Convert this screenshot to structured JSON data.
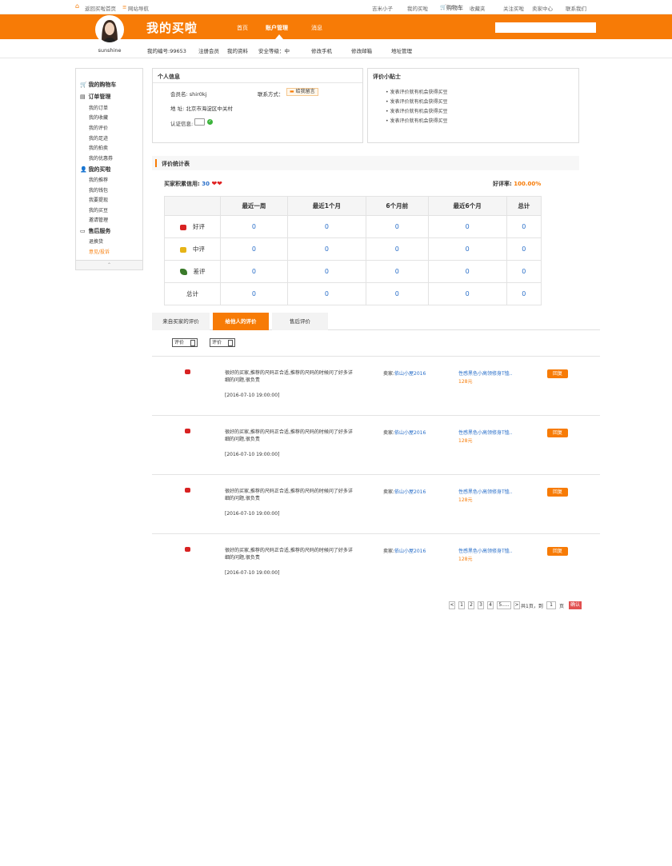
{
  "topbar": {
    "home": "返回买啦首页",
    "sitenav": "网站导航",
    "user": "吉米小子",
    "mybuy": "我的买啦",
    "cart": "购物车",
    "favorites": "收藏夹",
    "follow": "关注买啦",
    "seller": "卖家中心",
    "contact": "联系我们"
  },
  "header": {
    "brand": "我的买啦",
    "nav": [
      "首页",
      "账户管理",
      "消息"
    ],
    "search_placeholder": ""
  },
  "username": "sunshine",
  "subnav": {
    "member_no": "我的编号:99653",
    "items": [
      "注册会员",
      "我的资料",
      "安全等级：中",
      "修改手机",
      "修改邮箱",
      "地址管理"
    ]
  },
  "sidebar": {
    "sections": [
      {
        "title": "我的购物车",
        "items": []
      },
      {
        "title": "订单管理",
        "items": [
          "我的订单",
          "我的收藏",
          "我的评价",
          "我的足迹",
          "我的拍卖",
          "我的优惠券"
        ]
      },
      {
        "title": "我的买啦",
        "items": [
          "我的推荐",
          "我的钱包",
          "我要提现",
          "我的买豆",
          "邀请管理"
        ]
      },
      {
        "title": "售后服务",
        "items": [
          "退换货",
          "意见/投诉"
        ]
      }
    ],
    "fold": "⌃"
  },
  "personal": {
    "title": "个人信息",
    "member_name": "会员名: shir0kj",
    "contact_label": "联系方式：",
    "contact_btn": "给我留言",
    "address": "地  址: 北京市海淀区中关村",
    "auth_label": "认证信息:"
  },
  "tips": {
    "title": "评价小贴士",
    "items": [
      "发表评价就有机会获得买豆",
      "发表评价就有机会获得买豆",
      "发表评价就有机会获得买豆",
      "发表评价就有机会获得买豆"
    ]
  },
  "stats": {
    "title": "评价统计表",
    "credit_label": "买家积累信用:",
    "credit_value": "30",
    "rate_label": "好评率:",
    "rate_value": "100.00%",
    "headers": [
      "",
      "最近一周",
      "最近1个月",
      "6个月前",
      "最近6个月",
      "总计"
    ],
    "rows": [
      {
        "label": "好评",
        "values": [
          "0",
          "0",
          "0",
          "0",
          "0"
        ]
      },
      {
        "label": "中评",
        "values": [
          "0",
          "0",
          "0",
          "0",
          "0"
        ]
      },
      {
        "label": "差评",
        "values": [
          "0",
          "0",
          "0",
          "0",
          "0"
        ]
      },
      {
        "label": "总计",
        "values": [
          "0",
          "0",
          "0",
          "0",
          "0"
        ]
      }
    ]
  },
  "tabs": [
    "来自买家的评价",
    "给他人的评价",
    "售后评价"
  ],
  "filters": [
    "评价",
    "评价"
  ],
  "reviews": [
    {
      "text": "很好的买家,推荐的尺码正合适,推荐的尺码的时候问了好多详细的问题,很负责",
      "date": "[2016-07-10 19:00:00]",
      "seller_label": "卖家:",
      "seller": "依山小屋2016",
      "product": "性感黑色小高领修身T恤..",
      "price": "128元",
      "btn": "回复"
    },
    {
      "text": "很好的买家,推荐的尺码正合适,推荐的尺码的时候问了好多详细的问题,很负责",
      "date": "[2016-07-10 19:00:00]",
      "seller_label": "卖家:",
      "seller": "依山小屋2016",
      "product": "性感黑色小高领修身T恤..",
      "price": "128元",
      "btn": "回复"
    },
    {
      "text": "很好的买家,推荐的尺码正合适,推荐的尺码的时候问了好多详细的问题,很负责",
      "date": "[2016-07-10 19:00:00]",
      "seller_label": "卖家:",
      "seller": "依山小屋2016",
      "product": "性感黑色小高领修身T恤..",
      "price": "128元",
      "btn": "回复"
    },
    {
      "text": "很好的买家,推荐的尺码正合适,推荐的尺码的时候问了好多详细的问题,很负责",
      "date": "[2016-07-10 19:00:00]",
      "seller_label": "卖家:",
      "seller": "依山小屋2016",
      "product": "性感黑色小高领修身T恤..",
      "price": "128元",
      "btn": "回复"
    }
  ],
  "pagination": {
    "prev": "<",
    "pages": [
      "1",
      "2",
      "3",
      "4",
      "5....."
    ],
    "next": ">",
    "total": "共1页，到",
    "page_input": "1",
    "page_unit": "页",
    "confirm": "确认"
  },
  "colors": {
    "accent": "#f77b06",
    "link": "#2a6fc9"
  }
}
